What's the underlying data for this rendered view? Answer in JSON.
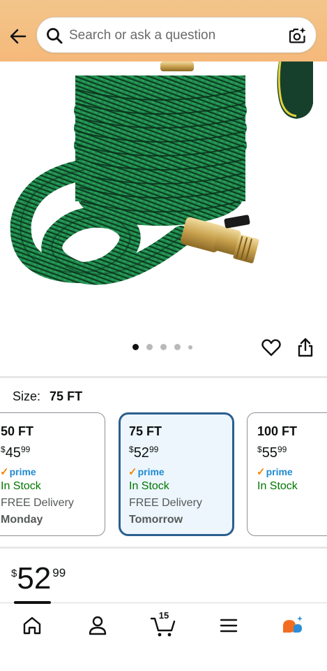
{
  "header": {
    "search_placeholder": "Search or ask a question",
    "background_color": "#f4be82"
  },
  "gallery": {
    "image_subject": "expandable-green-garden-hose",
    "dots_total": 5,
    "active_dot_index": 0
  },
  "size_selector": {
    "label": "Size:",
    "selected_value": "75 FT",
    "options": [
      {
        "size": "50 FT",
        "price_symbol": "$",
        "price_whole": "45",
        "price_cents": "99",
        "prime": "prime",
        "stock": "In Stock",
        "delivery": "FREE Delivery",
        "day": "Monday",
        "selected": false
      },
      {
        "size": "75 FT",
        "price_symbol": "$",
        "price_whole": "52",
        "price_cents": "99",
        "prime": "prime",
        "stock": "In Stock",
        "delivery": "FREE Delivery",
        "day": "Tomorrow",
        "selected": true
      },
      {
        "size": "100 FT",
        "price_symbol": "$",
        "price_whole": "55",
        "price_cents": "99",
        "prime": "prime",
        "stock": "In Stock",
        "delivery": "",
        "day": "",
        "selected": false
      }
    ]
  },
  "price": {
    "symbol": "$",
    "whole": "52",
    "cents": "99"
  },
  "bottom_nav": {
    "items": [
      "home-icon",
      "account-icon",
      "cart-icon",
      "menu-icon",
      "rufus-assistant-icon"
    ],
    "cart_count": "15",
    "active_index": 0
  },
  "colors": {
    "prime_blue": "#1f8bd1",
    "prime_check": "#f08804",
    "in_stock_green": "#007600",
    "selected_border": "#2a5f8e",
    "selected_bg": "#edf6fd"
  }
}
